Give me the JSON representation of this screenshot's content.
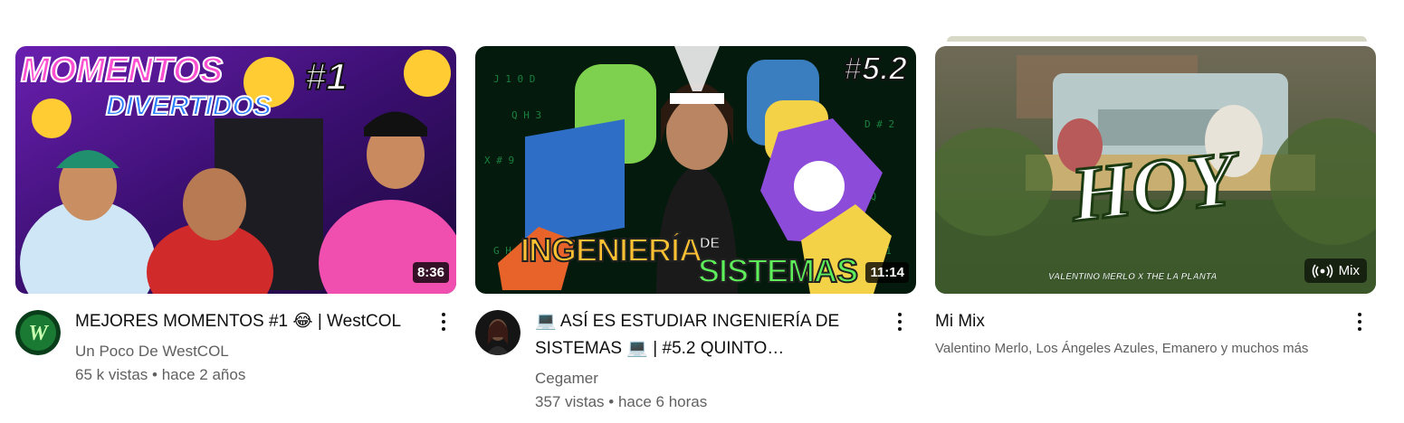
{
  "videos": [
    {
      "duration": "8:36",
      "thumb_text_1": "MOMENTOS",
      "thumb_text_2": "DIVERTIDOS",
      "thumb_text_3": "#1",
      "title": "MEJORES MOMENTOS #1 😂 | WestCOL",
      "channel": "Un Poco De WestCOL",
      "stats": "65 k vistas • hace 2 años"
    },
    {
      "duration": "11:14",
      "thumb_text_1": "#5.2",
      "thumb_text_2": "INGENIERÍA",
      "thumb_text_3": "DE",
      "thumb_text_4": "SISTEMAS",
      "title": "💻 ASÍ ES ESTUDIAR INGENIERÍA DE SISTEMAS 💻 | #5.2 QUINTO…",
      "channel": "Cegamer",
      "stats": "357 vistas • hace 6 horas"
    }
  ],
  "mix": {
    "badge_label": "Mix",
    "thumb_text_1": "HOY",
    "thumb_text_2": "VALENTINO MERLO X THE LA PLANTA",
    "title": "Mi Mix",
    "subtitle": "Valentino Merlo, Los Ángeles Azules, Emanero y muchos más"
  },
  "icons": {
    "more": "more-vert-icon",
    "mix": "radio-broadcast-icon"
  }
}
